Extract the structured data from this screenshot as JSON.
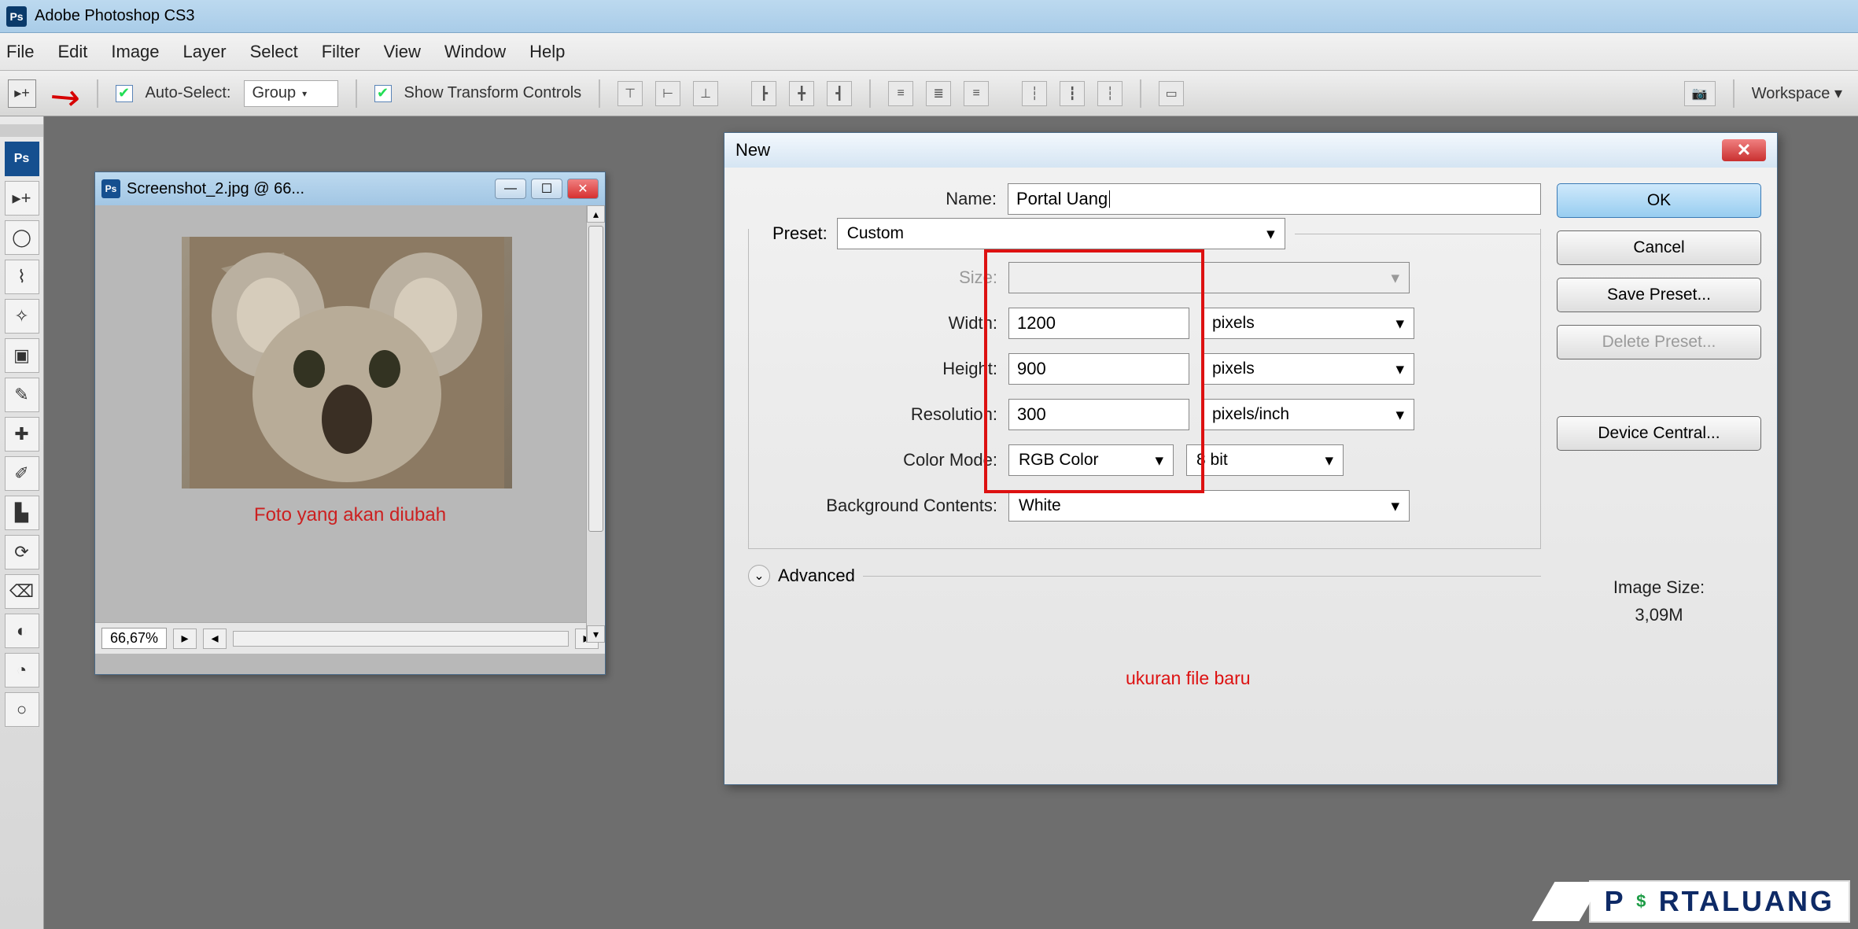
{
  "app": {
    "title": "Adobe Photoshop CS3"
  },
  "menu": [
    "File",
    "Edit",
    "Image",
    "Layer",
    "Select",
    "Filter",
    "View",
    "Window",
    "Help"
  ],
  "options": {
    "autoselect_label": "Auto-Select:",
    "autoselect_value": "Group",
    "show_tc_label": "Show Transform Controls",
    "workspace_label": "Workspace ▾"
  },
  "docwin": {
    "title": "Screenshot_2.jpg @ 66...",
    "caption": "Foto yang akan diubah",
    "zoom": "66,67%"
  },
  "dialog": {
    "title": "New",
    "labels": {
      "name": "Name:",
      "preset": "Preset:",
      "size": "Size:",
      "width": "Width:",
      "height": "Height:",
      "resolution": "Resolution:",
      "color_mode": "Color Mode:",
      "bg": "Background Contents:",
      "advanced": "Advanced"
    },
    "values": {
      "name": "Portal Uang",
      "preset": "Custom",
      "size": "",
      "width": "1200",
      "height": "900",
      "resolution": "300",
      "color_mode": "RGB Color",
      "bit_depth": "8 bit",
      "bg": "White",
      "width_unit": "pixels",
      "height_unit": "pixels",
      "res_unit": "pixels/inch"
    },
    "buttons": {
      "ok": "OK",
      "cancel": "Cancel",
      "save_preset": "Save Preset...",
      "delete_preset": "Delete Preset...",
      "device_central": "Device Central..."
    },
    "image_size_label": "Image Size:",
    "image_size_value": "3,09M",
    "annot": "ukuran file baru"
  },
  "watermark": {
    "p": "P",
    "rest": "RTALUANG"
  }
}
